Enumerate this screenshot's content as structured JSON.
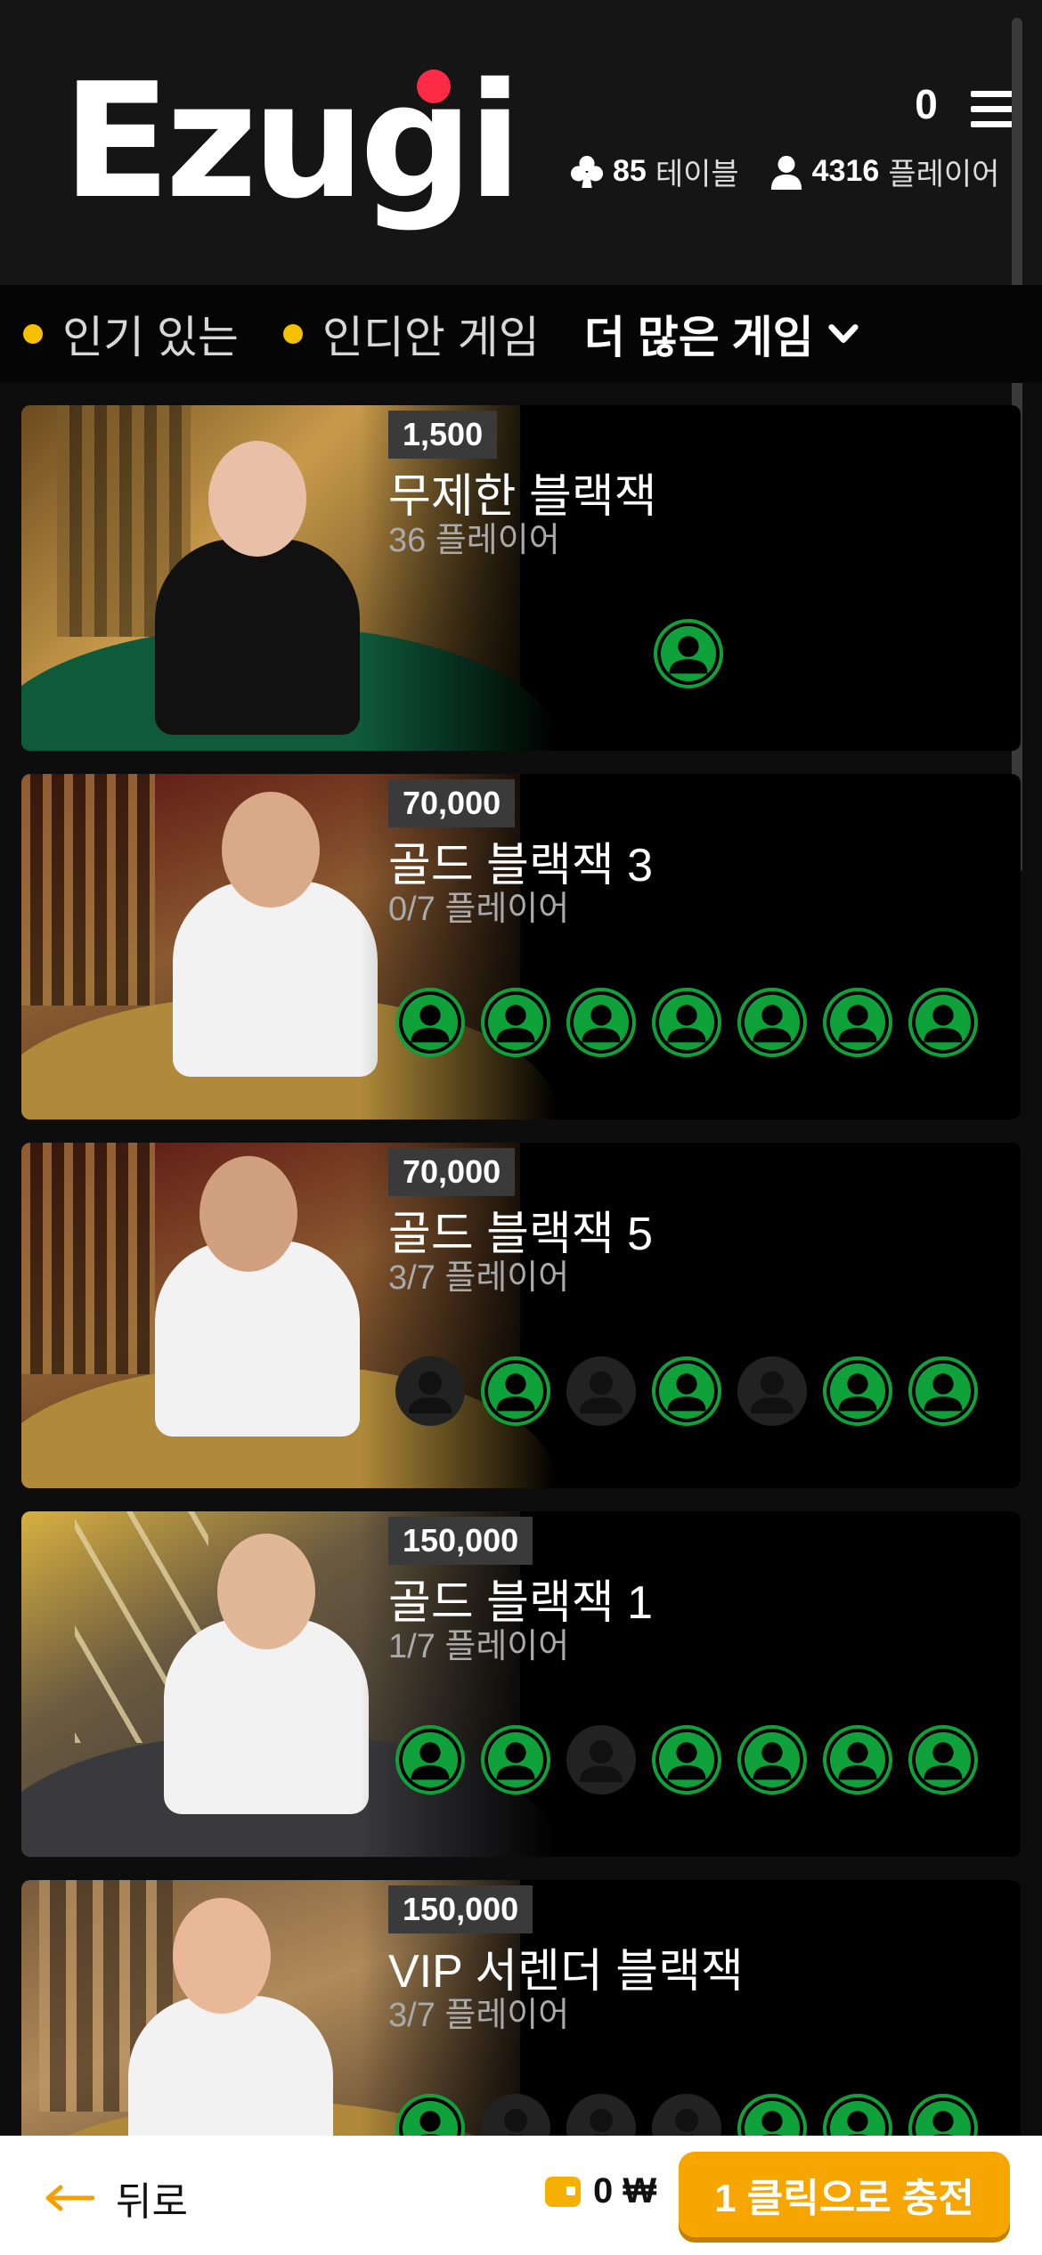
{
  "header": {
    "logo_text": "Ezugi",
    "balance_count": "0",
    "tables_count": "85",
    "tables_label": "테이블",
    "players_count": "4316",
    "players_label": "플레이어"
  },
  "nav": {
    "items": [
      {
        "label": "인기 있는"
      },
      {
        "label": "인디안 게임"
      }
    ],
    "more_label": "더 많은 게임"
  },
  "games": [
    {
      "limit": "1,500",
      "title": "무제한 블랙잭",
      "players": "36 플레이어",
      "seats": [
        "on"
      ]
    },
    {
      "limit": "70,000",
      "title": "골드 블랙잭 3",
      "players": "0/7 플레이어",
      "seats": [
        "on",
        "on",
        "on",
        "on",
        "on",
        "on",
        "on"
      ]
    },
    {
      "limit": "70,000",
      "title": "골드 블랙잭 5",
      "players": "3/7 플레이어",
      "seats": [
        "off",
        "on",
        "off",
        "on",
        "off",
        "on",
        "on"
      ]
    },
    {
      "limit": "150,000",
      "title": "골드 블랙잭 1",
      "players": "1/7 플레이어",
      "seats": [
        "on",
        "on",
        "off",
        "on",
        "on",
        "on",
        "on"
      ]
    },
    {
      "limit": "150,000",
      "title": "VIP 서렌더 블랙잭",
      "players": "3/7 플레이어",
      "seats": [
        "on",
        "off",
        "off",
        "off",
        "on",
        "on",
        "on"
      ]
    }
  ],
  "bottom": {
    "back_label": "뒤로",
    "wallet_amount": "0 ₩",
    "charge_label": "1 클릭으로 충전"
  },
  "colors": {
    "accent_yellow": "#f5c000",
    "seat_green": "#0fa23a",
    "charge_button": "#f7a600",
    "brand_dot": "#ff2a45"
  }
}
